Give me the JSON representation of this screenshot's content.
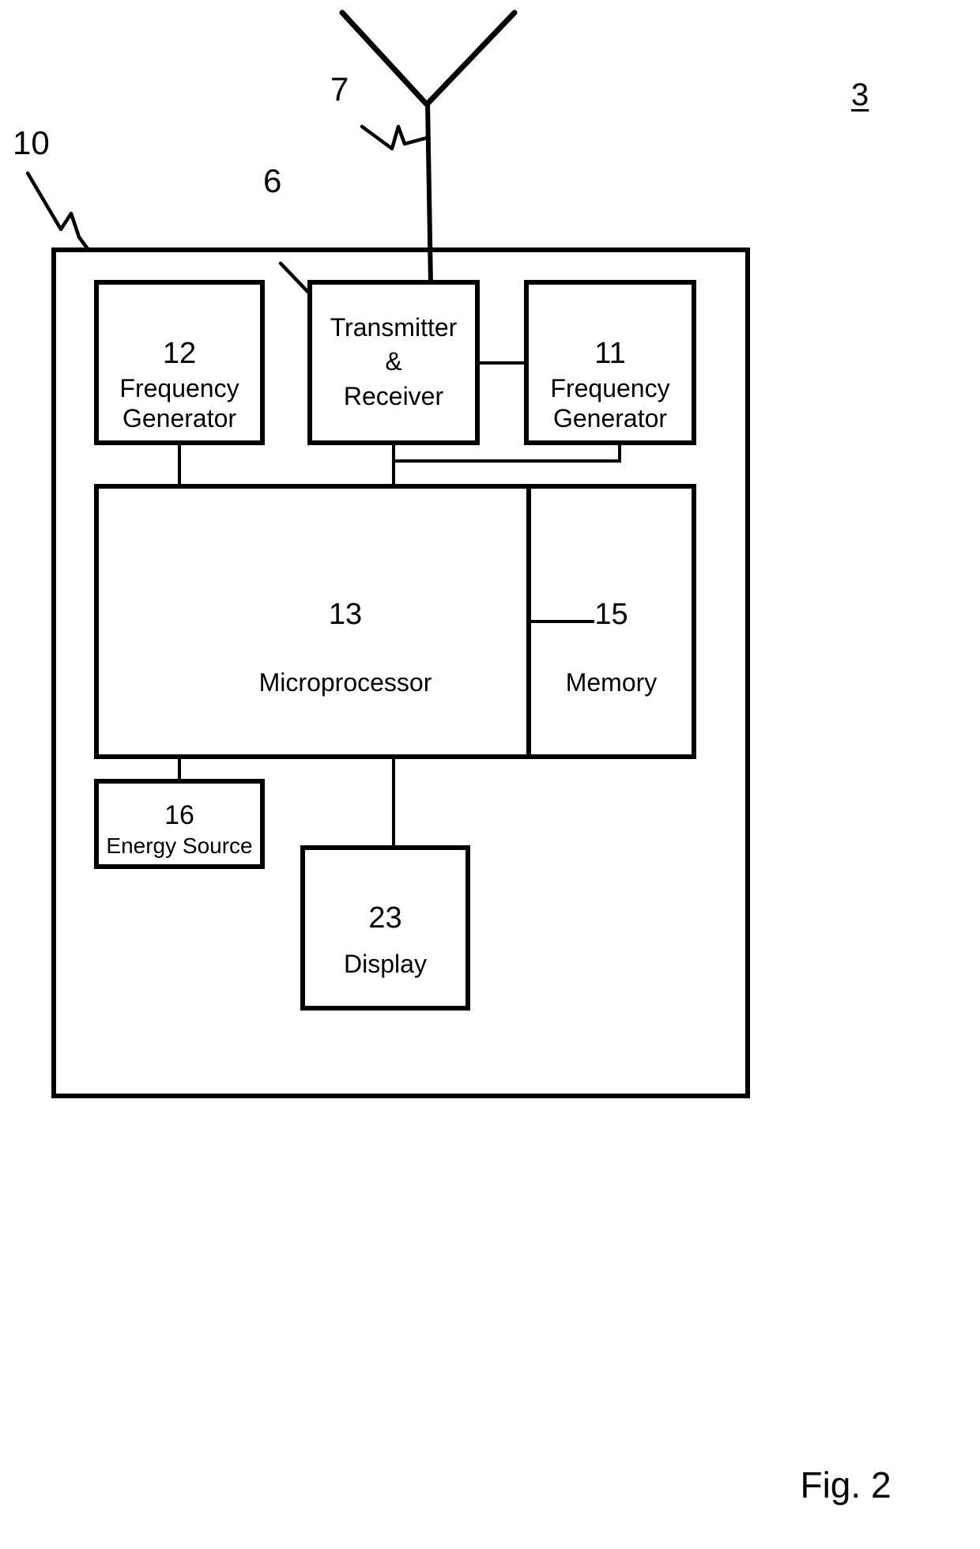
{
  "figure": {
    "caption": "Fig. 2",
    "device_reference": "3"
  },
  "reference_numerals": {
    "device": "3",
    "antenna": "7",
    "transceiver": "6",
    "housing": "10"
  },
  "blocks": [
    {
      "id": "frequency-generator-12",
      "number": "12",
      "label_line1": "Frequency",
      "label_line2": "Generator"
    },
    {
      "id": "transmitter-receiver",
      "line1": "Transmitter",
      "line2": "&",
      "line3": "Receiver"
    },
    {
      "id": "frequency-generator-11",
      "number": "11",
      "label_line1": "Frequency",
      "label_line2": "Generator"
    },
    {
      "id": "microprocessor-13",
      "number": "13",
      "label": "Microprocessor"
    },
    {
      "id": "memory-15",
      "number": "15",
      "label": "Memory"
    },
    {
      "id": "energy-source-16",
      "number": "16",
      "label": "Energy Source"
    },
    {
      "id": "display-23",
      "number": "23",
      "label": "Display"
    }
  ],
  "colors": {
    "stroke": "#000000",
    "background": "#ffffff"
  }
}
